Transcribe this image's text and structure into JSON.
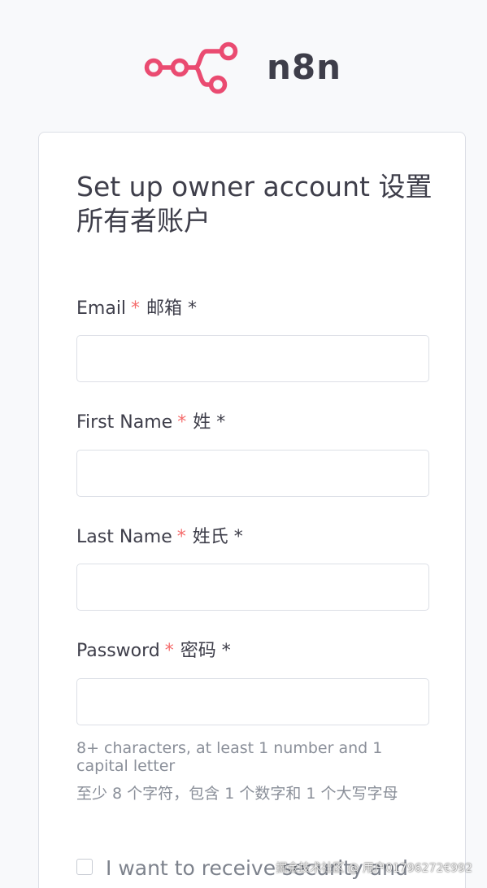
{
  "brand": {
    "name": "n8n",
    "logo_icon": "n8n-logo-icon",
    "logo_color": "#ea4b71"
  },
  "form": {
    "title": "Set up owner account 设置所有者账户",
    "required_mark": "*",
    "email": {
      "label": "Email",
      "label_cn": "邮箱 *",
      "value": "",
      "placeholder": ""
    },
    "first_name": {
      "label": "First Name",
      "label_cn": "姓 *",
      "value": "",
      "placeholder": ""
    },
    "last_name": {
      "label": "Last Name",
      "label_cn": "姓氏 *",
      "value": "",
      "placeholder": ""
    },
    "password": {
      "label": "Password",
      "label_cn": "密码 *",
      "value": "",
      "placeholder": "",
      "hint": "8+ characters, at least 1 number and 1 capital letter",
      "hint_cn": "至少 8 个字符，包含 1 个数字和 1 个大写字母"
    },
    "security_opt_in": {
      "label": "I want to receive security and",
      "checked": false
    }
  },
  "watermark": {
    "text": "掘金技术社区 @ 用户01796272€992"
  },
  "colors": {
    "accent": "#ea4b71",
    "required": "#f56c6c",
    "background": "#f8f9fb",
    "card": "#ffffff",
    "border": "#dcdfe6"
  }
}
